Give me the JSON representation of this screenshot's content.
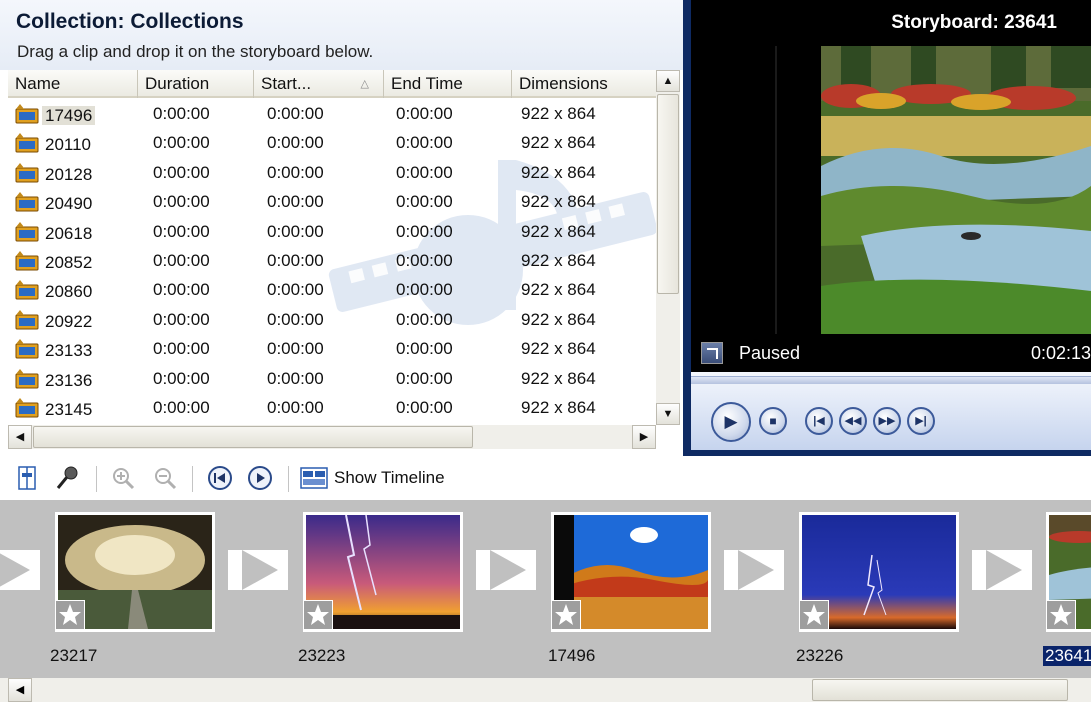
{
  "collection": {
    "title": "Collection: Collections",
    "subtitle": "Drag a clip and drop it on the storyboard below.",
    "columns": [
      {
        "label": "Name"
      },
      {
        "label": "Duration"
      },
      {
        "label": "Start..."
      },
      {
        "label": "End Time"
      },
      {
        "label": "Dimensions"
      }
    ],
    "sorted_column": "Start...",
    "rows": [
      {
        "name": "17496",
        "duration": "0:00:00",
        "start": "0:00:00",
        "end": "0:00:00",
        "dims": "922 x 864",
        "selected": true
      },
      {
        "name": "20110",
        "duration": "0:00:00",
        "start": "0:00:00",
        "end": "0:00:00",
        "dims": "922 x 864"
      },
      {
        "name": "20128",
        "duration": "0:00:00",
        "start": "0:00:00",
        "end": "0:00:00",
        "dims": "922 x 864"
      },
      {
        "name": "20490",
        "duration": "0:00:00",
        "start": "0:00:00",
        "end": "0:00:00",
        "dims": "922 x 864"
      },
      {
        "name": "20618",
        "duration": "0:00:00",
        "start": "0:00:00",
        "end": "0:00:00",
        "dims": "922 x 864"
      },
      {
        "name": "20852",
        "duration": "0:00:00",
        "start": "0:00:00",
        "end": "0:00:00",
        "dims": "922 x 864"
      },
      {
        "name": "20860",
        "duration": "0:00:00",
        "start": "0:00:00",
        "end": "0:00:00",
        "dims": "922 x 864"
      },
      {
        "name": "20922",
        "duration": "0:00:00",
        "start": "0:00:00",
        "end": "0:00:00",
        "dims": "922 x 864"
      },
      {
        "name": "23133",
        "duration": "0:00:00",
        "start": "0:00:00",
        "end": "0:00:00",
        "dims": "922 x 864"
      },
      {
        "name": "23136",
        "duration": "0:00:00",
        "start": "0:00:00",
        "end": "0:00:00",
        "dims": "922 x 864"
      },
      {
        "name": "23145",
        "duration": "0:00:00",
        "start": "0:00:00",
        "end": "0:00:00",
        "dims": "922 x 864"
      }
    ]
  },
  "monitor": {
    "title": "Storyboard: 23641",
    "status": "Paused",
    "time": "0:02:13"
  },
  "toolbar": {
    "show_timeline_label": "Show Timeline"
  },
  "storyboard": {
    "clips": [
      {
        "label": "23217",
        "scene": "storm-road"
      },
      {
        "label": "23223",
        "scene": "lightning-sunset"
      },
      {
        "label": "17496",
        "scene": "autumn-lake"
      },
      {
        "label": "23226",
        "scene": "lightning-night"
      },
      {
        "label": "23641",
        "scene": "marsh",
        "selected": true
      }
    ]
  },
  "colors": {
    "monitor_frame": "#0e2a63",
    "storyboard_bg": "#c0c0c0",
    "selection": "#0a246a"
  },
  "icons": {
    "clip": "video-clip-icon",
    "sort": "sort-ascending-icon",
    "fullscreen": "fullscreen-icon",
    "play": "play-icon",
    "stop": "stop-icon",
    "prev": "previous-frame-icon",
    "rewind": "rewind-icon",
    "forward": "fast-forward-icon",
    "next": "next-frame-icon",
    "effect": "video-effect-star-icon"
  }
}
